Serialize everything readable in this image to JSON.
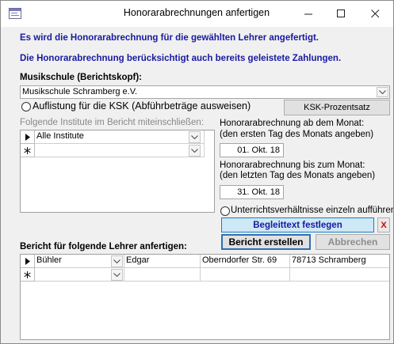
{
  "window": {
    "title": "Honorarabrechnungen anfertigen"
  },
  "messages": {
    "line1": "Es wird die Honorarabrechnung für die gewählten Lehrer angefertigt.",
    "line2": "Die Honorarabrechnung berücksichtigt auch bereits geleistete Zahlungen."
  },
  "musikschule": {
    "label": "Musikschule (Berichtskopf):",
    "value": "Musikschule Schramberg e.V."
  },
  "ksk": {
    "radio_label": "Auflistung für die KSK (Abführbeträge ausweisen)",
    "button_label": "KSK-Prozentsatz"
  },
  "institute": {
    "label": "Folgende Institute im Bericht miteinschließen:",
    "rows": [
      {
        "name": "Alle Institute"
      }
    ]
  },
  "von": {
    "label_line1": "Honorarabrechnung ab dem Monat:",
    "label_line2": "(den ersten Tag des Monats angeben)",
    "value": "01. Okt. 18"
  },
  "bis": {
    "label_line1": "Honorarabrechnung bis zum Monat:",
    "label_line2": "(den letzten Tag des Monats angeben)",
    "value": "31. Okt. 18"
  },
  "einzeln": {
    "label": "Unterrichtsverhältnisse einzeln aufführen"
  },
  "begleittext": {
    "label": "Begleittext festlegen",
    "clear_label": "X"
  },
  "actions": {
    "create": "Bericht erstellen",
    "cancel": "Abbrechen"
  },
  "lehrer": {
    "label": "Bericht für folgende Lehrer anfertigen:",
    "rows": [
      {
        "nachname": "Bühler",
        "vorname": "Edgar",
        "strasse": "Oberndorfer Str. 69",
        "ort": "78713 Schramberg"
      }
    ]
  },
  "colors": {
    "accent_text": "#1919a0",
    "begleit_bg": "#cde8f6",
    "clear_red": "#d00000"
  }
}
